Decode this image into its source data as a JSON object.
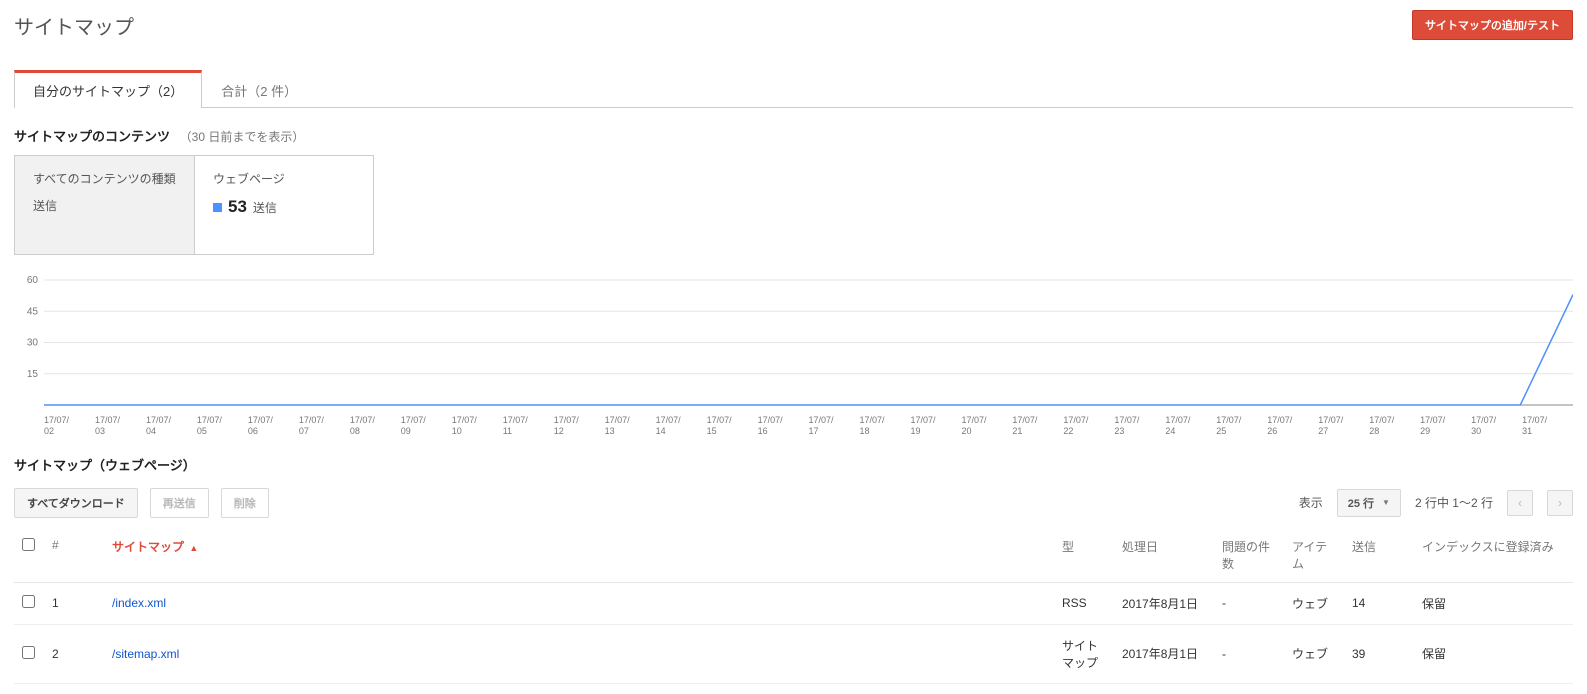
{
  "header": {
    "title": "サイトマップ",
    "add_button": "サイトマップの追加/テスト"
  },
  "tabs": {
    "mine": "自分のサイトマップ（2）",
    "total": "合計（2 件）"
  },
  "contents": {
    "heading": "サイトマップのコンテンツ",
    "sub": "（30 日前までを表示）",
    "box_all_line1": "すべてのコンテンツの種類",
    "box_all_line2": "送信",
    "box_web_line1": "ウェブページ",
    "box_web_value": "53",
    "box_web_label": "送信"
  },
  "chart_data": {
    "type": "line",
    "title": "",
    "xlabel": "",
    "ylabel": "",
    "ylim": [
      0,
      60
    ],
    "y_ticks": [
      15,
      30,
      45,
      60
    ],
    "categories": [
      "17/07/02",
      "17/07/03",
      "17/07/04",
      "17/07/05",
      "17/07/06",
      "17/07/07",
      "17/07/08",
      "17/07/09",
      "17/07/10",
      "17/07/11",
      "17/07/12",
      "17/07/13",
      "17/07/14",
      "17/07/15",
      "17/07/16",
      "17/07/17",
      "17/07/18",
      "17/07/19",
      "17/07/20",
      "17/07/21",
      "17/07/22",
      "17/07/23",
      "17/07/24",
      "17/07/25",
      "17/07/26",
      "17/07/27",
      "17/07/28",
      "17/07/29",
      "17/07/30",
      "17/07/31"
    ],
    "series": [
      {
        "name": "送信",
        "color": "#4d90fe",
        "values": [
          0,
          0,
          0,
          0,
          0,
          0,
          0,
          0,
          0,
          0,
          0,
          0,
          0,
          0,
          0,
          0,
          0,
          0,
          0,
          0,
          0,
          0,
          0,
          0,
          0,
          0,
          0,
          0,
          0,
          53
        ]
      }
    ]
  },
  "list": {
    "heading": "サイトマップ（ウェブページ）",
    "btn_download": "すべてダウンロード",
    "btn_resend": "再送信",
    "btn_delete": "削除",
    "show_label": "表示",
    "rows_select": "25 行",
    "pager_label": "2 行中 1〜2 行",
    "columns": {
      "num": "#",
      "sitemap": "サイトマップ",
      "type": "型",
      "processed": "処理日",
      "issues": "問題の件数",
      "items": "アイテム",
      "sent": "送信",
      "indexed": "インデックスに登録済み"
    },
    "rows": [
      {
        "num": "1",
        "sitemap": "/index.xml",
        "type": "RSS",
        "processed": "2017年8月1日",
        "issues": "-",
        "items": "ウェブ",
        "sent": "14",
        "indexed": "保留"
      },
      {
        "num": "2",
        "sitemap": "/sitemap.xml",
        "type": "サイトマップ",
        "processed": "2017年8月1日",
        "issues": "-",
        "items": "ウェブ",
        "sent": "39",
        "indexed": "保留"
      }
    ]
  }
}
